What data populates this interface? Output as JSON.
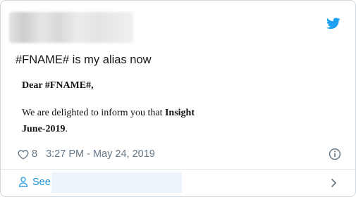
{
  "tweet": {
    "text": "#FNAME# is my alias now",
    "image": {
      "greeting": "Dear #FNAME#,",
      "body_prefix": "We are delighted to inform you that ",
      "body_bold": "Insight",
      "date": "June-2019",
      "date_suffix": "."
    },
    "likes": "8",
    "timestamp": "3:27 PM - May 24, 2019"
  },
  "footer": {
    "see_label": "See"
  },
  "colors": {
    "accent": "#1da1f2",
    "link": "#1b95e0",
    "meta": "#657786",
    "border": "#cfd9de"
  },
  "icons": [
    "twitter-bird-icon",
    "heart-icon",
    "info-icon",
    "person-icon",
    "chevron-right-icon"
  ]
}
